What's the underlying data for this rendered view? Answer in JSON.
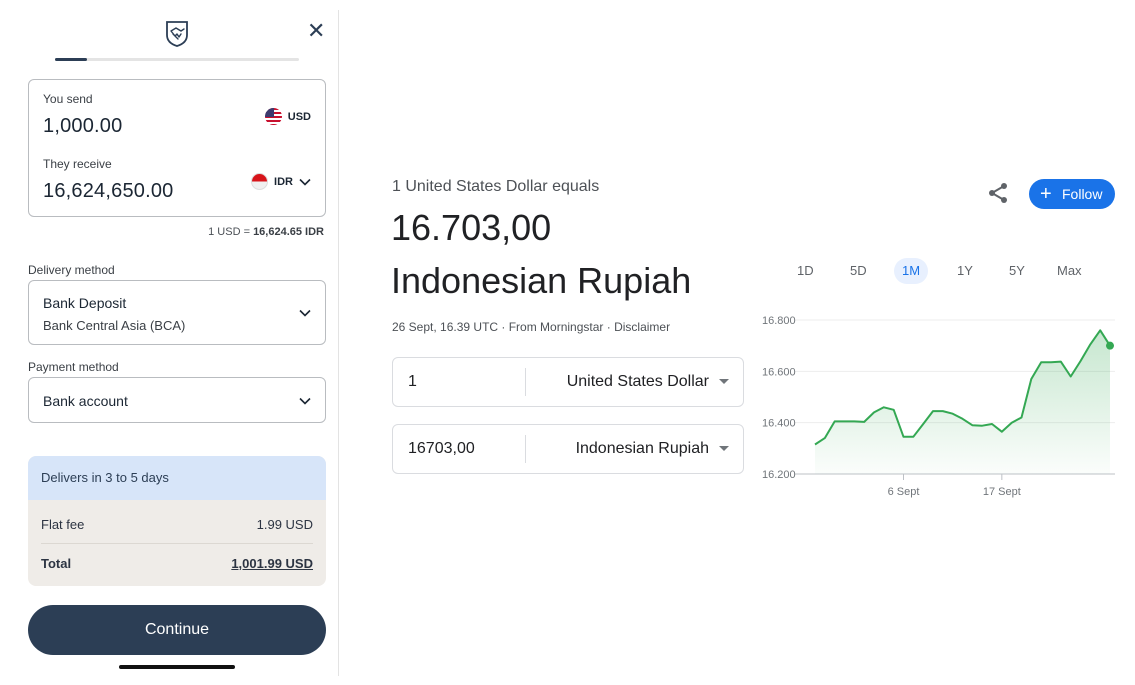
{
  "remit": {
    "progress_fraction": 0.13,
    "close_glyph": "✕",
    "send": {
      "label": "You send",
      "amount": "1,000.00",
      "currency": "USD"
    },
    "receive": {
      "label": "They receive",
      "amount": "16,624,650.00",
      "currency": "IDR"
    },
    "rate": {
      "prefix": "1 USD = ",
      "value": "16,624.65 IDR"
    },
    "delivery": {
      "label": "Delivery method",
      "title": "Bank Deposit",
      "subtitle": "Bank Central Asia (BCA)"
    },
    "payment": {
      "label": "Payment method",
      "value": "Bank account"
    },
    "summary": {
      "delivers": "Delivers in 3 to 5 days",
      "fee_label": "Flat fee",
      "fee_value": "1.99 USD",
      "total_label": "Total",
      "total_value": "1,001.99 USD"
    },
    "continue_label": "Continue",
    "colors": {
      "navy": "#2c3e55",
      "summary_blue": "#d7e5f9",
      "summary_bg": "#efece8"
    }
  },
  "finance": {
    "equals_label": "1 United States Dollar equals",
    "rate_value": "16.703,00",
    "rate_currency": "Indonesian Rupiah",
    "source_line": "26 Sept, 16.39 UTC · From Morningstar · Disclaimer",
    "follow_label": "Follow",
    "converter": [
      {
        "amount": "1",
        "currency": "United States Dollar"
      },
      {
        "amount": "16703,00",
        "currency": "Indonesian Rupiah"
      }
    ],
    "ranges": [
      "1D",
      "5D",
      "1M",
      "1Y",
      "5Y",
      "Max"
    ],
    "active_range": "1M",
    "colors": {
      "accent": "#1a73e8",
      "line": "#34a853"
    }
  },
  "chart_data": {
    "type": "area",
    "ylim": [
      16200,
      16800
    ],
    "y_ticks": [
      16200,
      16400,
      16600,
      16800
    ],
    "y_tick_labels": [
      "16.200",
      "16.400",
      "16.600",
      "16.800"
    ],
    "x_ticks": [
      {
        "label": "6 Sept",
        "index": 9
      },
      {
        "label": "17 Sept",
        "index": 19
      }
    ],
    "grid": true,
    "series": [
      {
        "values": [
          16315,
          16340,
          16405,
          16405,
          16405,
          16403,
          16440,
          16460,
          16450,
          16345,
          16345,
          16395,
          16445,
          16445,
          16435,
          16415,
          16390,
          16388,
          16395,
          16365,
          16400,
          16420,
          16570,
          16635,
          16635,
          16638,
          16580,
          16640,
          16705,
          16760,
          16700
        ]
      }
    ]
  }
}
